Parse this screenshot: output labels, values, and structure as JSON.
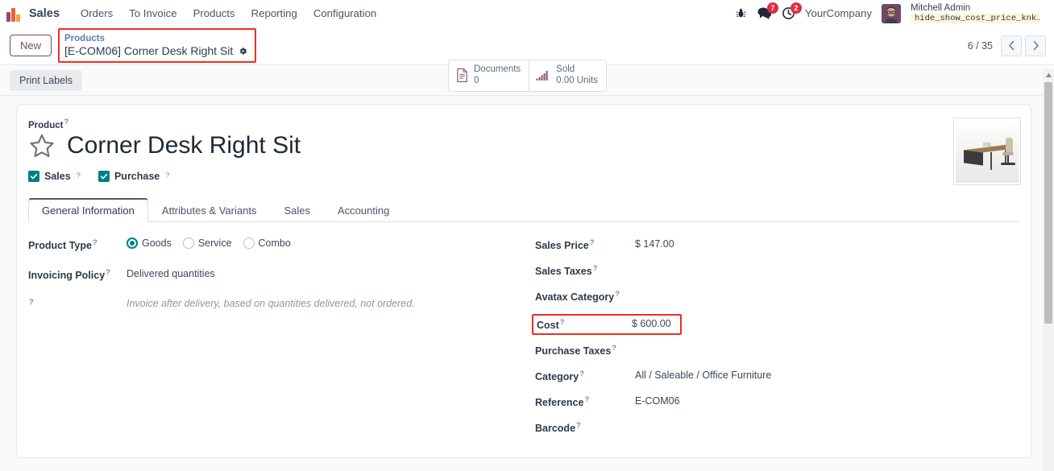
{
  "navbar": {
    "app_name": "Sales",
    "menu_items": [
      {
        "label": "Orders"
      },
      {
        "label": "To Invoice"
      },
      {
        "label": "Products"
      },
      {
        "label": "Reporting"
      },
      {
        "label": "Configuration"
      }
    ],
    "bug_icon": "bug-icon",
    "messages": {
      "icon": "messages-icon",
      "count": "7"
    },
    "activities": {
      "icon": "activities-clock-icon",
      "count": "2"
    },
    "company": "YourCompany",
    "user": {
      "name": "Mitchell Admin",
      "database": "hide_show_cost_price_knk…",
      "database_icon": "database-icon"
    }
  },
  "control_panel": {
    "new_label": "New",
    "breadcrumb": {
      "parent": "Products",
      "current": "[E-COM06] Corner Desk Right Sit",
      "gear_icon": "gear-icon",
      "highlighted": true
    },
    "stat_buttons": [
      {
        "icon": "document-icon",
        "label": "Documents",
        "value": "0"
      },
      {
        "icon": "bar-chart-icon",
        "label": "Sold",
        "value": "0.00 Units"
      }
    ],
    "pager": {
      "count": "6 / 35",
      "prev_icon": "chevron-left-icon",
      "next_icon": "chevron-right-icon"
    }
  },
  "action_bar": {
    "print_labels_label": "Print Labels"
  },
  "form": {
    "product_label": "Product",
    "help_marker": "?",
    "star_icon": "star-outline-icon",
    "title": "Corner Desk Right Sit",
    "image_alt": "corner-desk-photo",
    "checkboxes": [
      {
        "label": "Sales",
        "checked": true
      },
      {
        "label": "Purchase",
        "checked": true
      }
    ],
    "tabs": [
      {
        "label": "General Information",
        "active": true
      },
      {
        "label": "Attributes & Variants",
        "active": false
      },
      {
        "label": "Sales",
        "active": false
      },
      {
        "label": "Accounting",
        "active": false
      }
    ],
    "left_fields": {
      "product_type": {
        "label": "Product Type",
        "options": [
          {
            "label": "Goods",
            "selected": true
          },
          {
            "label": "Service",
            "selected": false
          },
          {
            "label": "Combo",
            "selected": false
          }
        ]
      },
      "invoicing_policy": {
        "label": "Invoicing Policy",
        "value": "Delivered quantities"
      },
      "invoicing_hint": {
        "label": "",
        "value": "Invoice after delivery, based on quantities delivered, not ordered."
      }
    },
    "right_fields": [
      {
        "label": "Sales Price",
        "value": "$ 147.00",
        "highlighted": false
      },
      {
        "label": "Sales Taxes",
        "value": "",
        "highlighted": false
      },
      {
        "label": "Avatax Category",
        "value": "",
        "highlighted": false
      },
      {
        "label": "Cost",
        "value": "$ 600.00",
        "highlighted": true
      },
      {
        "label": "Purchase Taxes",
        "value": "",
        "highlighted": false
      },
      {
        "label": "Category",
        "value": "All / Saleable / Office Furniture",
        "highlighted": false
      },
      {
        "label": "Reference",
        "value": "E-COM06",
        "highlighted": false
      },
      {
        "label": "Barcode",
        "value": "",
        "highlighted": false
      }
    ]
  },
  "colors": {
    "accent_purple": "#714b67",
    "highlight_red": "#ee2d24",
    "checkbox_teal": "#017e84",
    "badge_red": "#e02c43",
    "link_blue": "#5a7fa8"
  }
}
